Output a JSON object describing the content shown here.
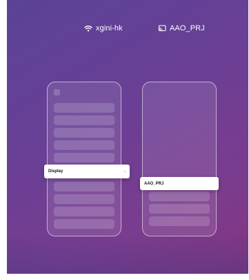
{
  "status_bar": {
    "wifi_icon": "wifi-icon",
    "wifi_name": "xgini-hk",
    "cast_icon": "screen-cast-icon",
    "cast_target": "AAO_PRJ"
  },
  "left_phone": {
    "menu_item_label": "Display",
    "menu_item_icon": "chevron-right-icon",
    "chevron": "›"
  },
  "right_phone": {
    "device_label": "AAO_PRJ"
  },
  "colors": {
    "background_start": "#5a4396",
    "background_end": "#83367f",
    "card": "#ffffff"
  }
}
